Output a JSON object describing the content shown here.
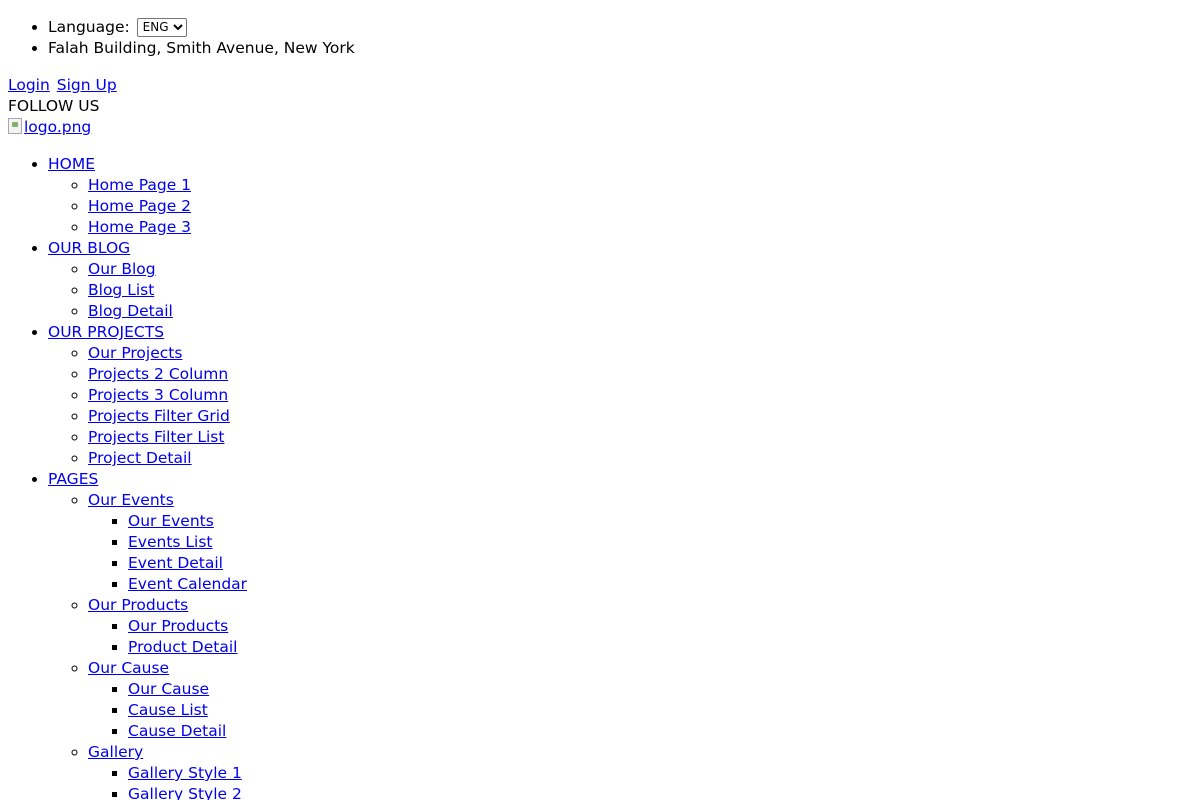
{
  "top_info": {
    "language_label": "Language:",
    "language_selected": "ENG",
    "address": "Falah Building, Smith Avenue, New York"
  },
  "auth": {
    "login": "Login",
    "signup": "Sign Up"
  },
  "follow_us": "FOLLOW US",
  "logo_alt": "logo.png",
  "nav": {
    "home": {
      "label": "HOME",
      "items": [
        "Home Page 1",
        "Home Page 2",
        "Home Page 3"
      ]
    },
    "blog": {
      "label": "OUR BLOG",
      "items": [
        "Our Blog",
        "Blog List",
        "Blog Detail"
      ]
    },
    "projects": {
      "label": "OUR PROJECTS",
      "items": [
        "Our Projects",
        "Projects 2 Column",
        "Projects 3 Column",
        "Projects Filter Grid",
        "Projects Filter List",
        "Project Detail"
      ]
    },
    "pages": {
      "label": "PAGES",
      "events": {
        "label": "Our Events",
        "items": [
          "Our Events",
          "Events List",
          "Event Detail",
          "Event Calendar"
        ]
      },
      "products": {
        "label": "Our Products",
        "items": [
          "Our Products",
          "Product Detail"
        ]
      },
      "cause": {
        "label": "Our Cause",
        "items": [
          "Our Cause",
          "Cause List",
          "Cause Detail"
        ]
      },
      "gallery": {
        "label": "Gallery",
        "items": [
          "Gallery Style 1",
          "Gallery Style 2"
        ]
      }
    }
  }
}
